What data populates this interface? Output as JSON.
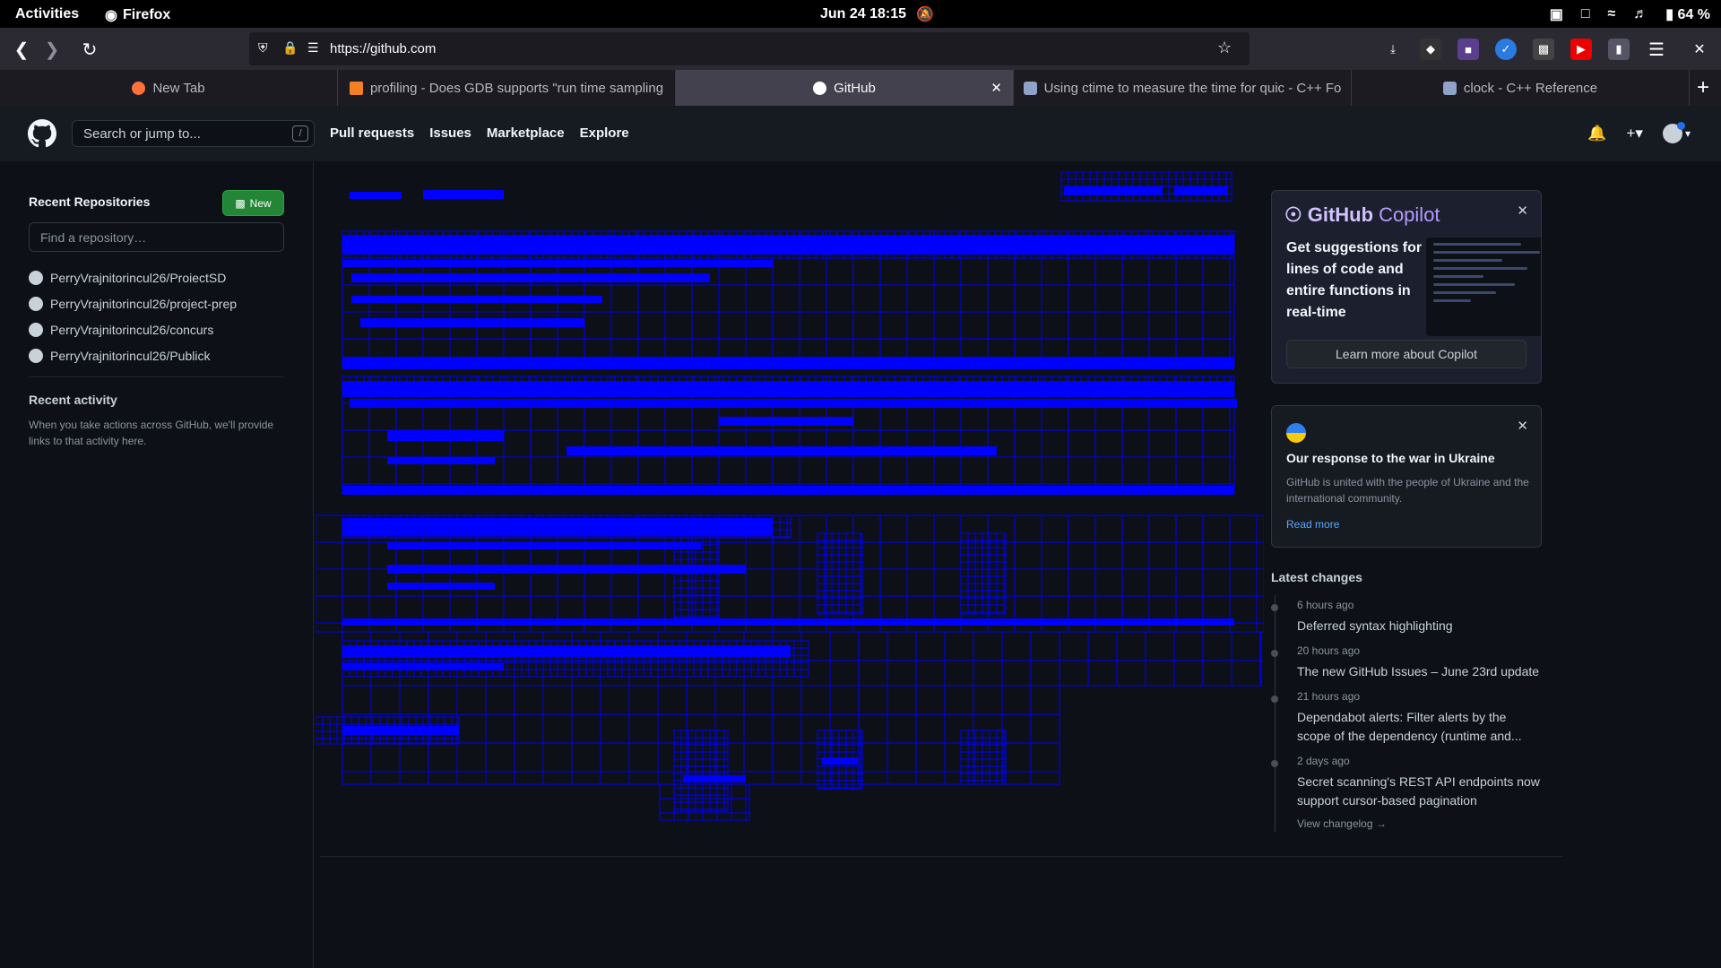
{
  "system_bar": {
    "activities": "Activities",
    "app_name": "Firefox",
    "datetime": "Jun 24  18:15",
    "battery": "64 %"
  },
  "browser": {
    "url": "https://github.com",
    "tabs": [
      {
        "label": "New Tab",
        "active": false
      },
      {
        "label": "profiling - Does GDB supports \"run time sampling",
        "active": false
      },
      {
        "label": "GitHub",
        "active": true
      },
      {
        "label": "Using ctime to measure the time for quic - C++ Fo",
        "active": false
      },
      {
        "label": "clock - C++ Reference",
        "active": false
      }
    ]
  },
  "github": {
    "search_placeholder": "Search or jump to...",
    "search_shortcut": "/",
    "nav": [
      "Pull requests",
      "Issues",
      "Marketplace",
      "Explore"
    ],
    "sidebar": {
      "recent_title": "Recent Repositories",
      "new_button": "New",
      "find_placeholder": "Find a repository…",
      "repos": [
        "PerryVrajnitorincul26/ProiectSD",
        "PerryVrajnitorincul26/project-prep",
        "PerryVrajnitorincul26/concurs",
        "PerryVrajnitorincul26/Publick"
      ],
      "activity_title": "Recent activity",
      "activity_text": "When you take actions across GitHub, we'll provide links to that activity here."
    },
    "copilot": {
      "brand": "GitHub",
      "product": "Copilot",
      "description": "Get suggestions for lines of code and entire functions in real-time",
      "cta": "Learn more about Copilot"
    },
    "ukraine": {
      "title": "Our response to the war in Ukraine",
      "text": "GitHub is united with the people of Ukraine and the international community.",
      "link": "Read more"
    },
    "latest_changes": {
      "title": "Latest changes",
      "items": [
        {
          "time": "6 hours ago",
          "title": "Deferred syntax highlighting"
        },
        {
          "time": "20 hours ago",
          "title": "The new GitHub Issues – June 23rd update"
        },
        {
          "time": "21 hours ago",
          "title": "Dependabot alerts: Filter alerts by the scope of the dependency (runtime and..."
        },
        {
          "time": "2 days ago",
          "title": "Secret scanning's REST API endpoints now support cursor-based pagination"
        }
      ],
      "changelog_link": "View changelog →"
    }
  },
  "colors": {
    "page_bg": "#0d1117",
    "header_bg": "#161b22",
    "artifact_blue": "#0000ff",
    "new_button_green": "#238636",
    "link_blue": "#58a6ff"
  }
}
